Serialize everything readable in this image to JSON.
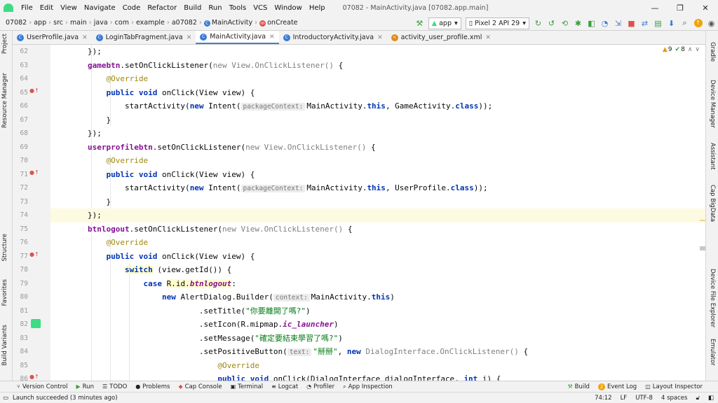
{
  "menubar": {
    "items": [
      "File",
      "Edit",
      "View",
      "Navigate",
      "Code",
      "Refactor",
      "Build",
      "Run",
      "Tools",
      "VCS",
      "Window",
      "Help"
    ],
    "title": "07082 - MainActivity.java [07082.app.main]",
    "controls": [
      "—",
      "❐",
      "✕"
    ]
  },
  "breadcrumbs": [
    "07082",
    "app",
    "src",
    "main",
    "java",
    "com",
    "example",
    "a07082",
    "MainActivity",
    "onCreate"
  ],
  "toolbar": {
    "run_config": "app",
    "device": "Pixel 2 API 29"
  },
  "tabs": [
    {
      "label": "UserProfile.java",
      "active": false,
      "icon_color": "#3a7bd5"
    },
    {
      "label": "LoginTabFragment.java",
      "active": false,
      "icon_color": "#3a7bd5"
    },
    {
      "label": "MainActivity.java",
      "active": true,
      "icon_color": "#3a7bd5"
    },
    {
      "label": "IntroductoryActivity.java",
      "active": false,
      "icon_color": "#3a7bd5"
    },
    {
      "label": "activity_user_profile.xml",
      "active": false,
      "icon_color": "#e08c1a"
    }
  ],
  "left_strip": [
    "Project",
    "Resource Manager",
    "Structure",
    "Favorites",
    "Build Variants"
  ],
  "right_strip": [
    "Gradle",
    "Device Manager",
    "Assistant",
    "Cap BigData",
    "Device File Explorer",
    "Emulator"
  ],
  "inspections": {
    "warnings": "9",
    "ok": "8"
  },
  "code": {
    "line_numbers": [
      "62",
      "63",
      "64",
      "65",
      "66",
      "67",
      "68",
      "69",
      "70",
      "71",
      "72",
      "73",
      "74",
      "75",
      "76",
      "77",
      "78",
      "79",
      "80",
      "81",
      "82",
      "83",
      "84",
      "85",
      "86"
    ],
    "hints": {
      "packageContext": "packageContext:",
      "context": "context:",
      "text": "text:"
    },
    "strings": {
      "leave": "\"你要離開了嗎?\"",
      "confirm": "\"確定要結束學習了嗎?\"",
      "bye": "\"掰掰\""
    }
  },
  "bottom_tools": [
    "Version Control",
    "Run",
    "TODO",
    "Problems",
    "Cap Console",
    "Terminal",
    "Logcat",
    "Profiler",
    "App Inspection"
  ],
  "bottom_tools_right": [
    "Build",
    "Event Log",
    "Layout Inspector"
  ],
  "event_log_badge": "2",
  "status": {
    "message": "Launch succeeded (3 minutes ago)",
    "position": "74:12",
    "line_sep": "LF",
    "encoding": "UTF-8",
    "indent": "4 spaces"
  },
  "colors": {
    "accent": "#4083c9",
    "android_green": "#3ddc84",
    "keyword": "#0033b3",
    "field": "#871094",
    "annotation": "#9e880d",
    "string": "#067d17"
  }
}
